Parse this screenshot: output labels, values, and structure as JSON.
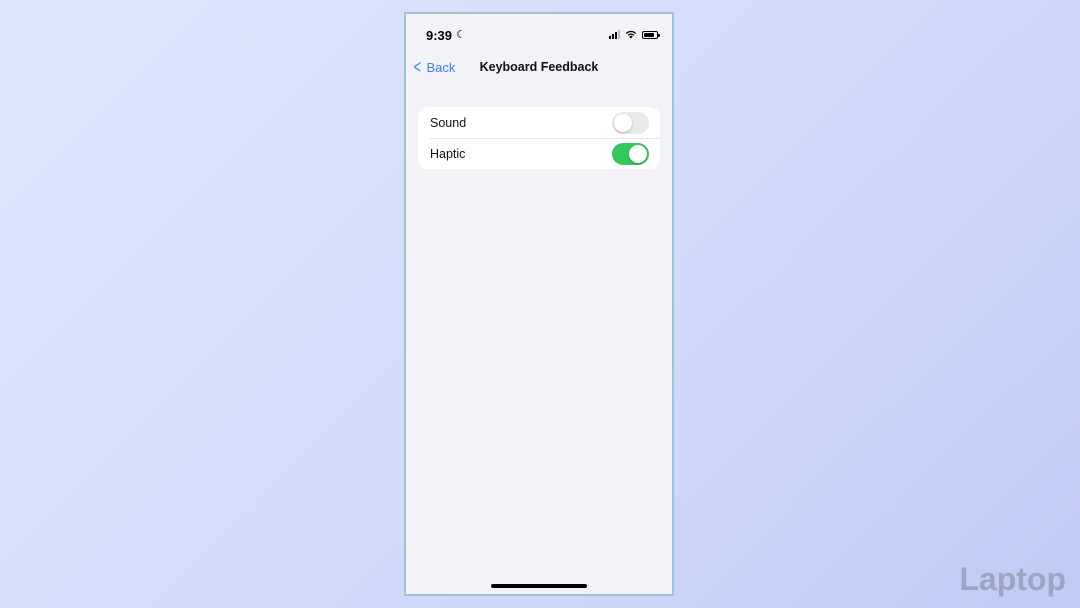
{
  "status_bar": {
    "time": "9:39",
    "focus_icon": "moon-icon",
    "icons": [
      "cellular-signal-icon",
      "wifi-icon",
      "battery-icon"
    ]
  },
  "nav": {
    "back_label": "Back",
    "title": "Keyboard Feedback"
  },
  "settings": [
    {
      "label": "Sound",
      "enabled": false
    },
    {
      "label": "Haptic",
      "enabled": true
    }
  ],
  "colors": {
    "accent": "#3a82f7",
    "toggle_on": "#34c759",
    "toggle_off": "#e9e9eb"
  },
  "watermark": "Laptop"
}
